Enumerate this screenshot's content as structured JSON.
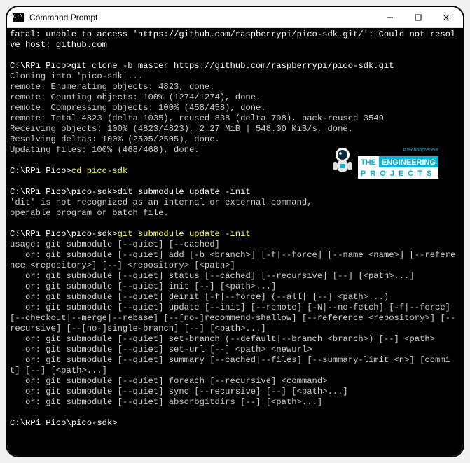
{
  "titlebar": {
    "icon_label": "C:\\",
    "title": "Command Prompt"
  },
  "logo": {
    "tag": "# technopreneur",
    "line1a": "THE",
    "line1b": "ENGINEERING",
    "line2": "PROJECTS"
  },
  "terminal_lines": [
    {
      "cls": "w",
      "text": "fatal: unable to access 'https://github.com/raspberrypi/pico-sdk.git/': Could not resolve host: github.com"
    },
    {
      "cls": "w",
      "text": ""
    },
    {
      "cls": "prompt",
      "text": "C:\\RPi Pico>git clone -b master https://github.com/raspberrypi/pico-sdk.git"
    },
    {
      "cls": "line",
      "text": "Cloning into 'pico-sdk'..."
    },
    {
      "cls": "line",
      "text": "remote: Enumerating objects: 4823, done."
    },
    {
      "cls": "line",
      "text": "remote: Counting objects: 100% (1274/1274), done."
    },
    {
      "cls": "line",
      "text": "remote: Compressing objects: 100% (458/458), done."
    },
    {
      "cls": "line",
      "text": "remote: Total 4823 (delta 1035), reused 838 (delta 798), pack-reused 3549"
    },
    {
      "cls": "line",
      "text": "Receiving objects: 100% (4823/4823), 2.27 MiB | 548.00 KiB/s, done."
    },
    {
      "cls": "line",
      "text": "Resolving deltas: 100% (2505/2505), done."
    },
    {
      "cls": "line",
      "text": "Updating files: 100% (468/468), done."
    },
    {
      "cls": "w",
      "text": ""
    },
    {
      "cls": "mixed",
      "prefix": "C:\\RPi Pico>",
      "cmd": "cd pico-sdk"
    },
    {
      "cls": "w",
      "text": ""
    },
    {
      "cls": "prompt",
      "text": "C:\\RPi Pico\\pico-sdk>dit submodule update -init"
    },
    {
      "cls": "line",
      "text": "'dit' is not recognized as an internal or external command,"
    },
    {
      "cls": "line",
      "text": "operable program or batch file."
    },
    {
      "cls": "w",
      "text": ""
    },
    {
      "cls": "mixed",
      "prefix": "C:\\RPi Pico\\pico-sdk>",
      "cmd": "git submodule update -init"
    },
    {
      "cls": "line",
      "text": "usage: git submodule [--quiet] [--cached]"
    },
    {
      "cls": "line",
      "text": "   or: git submodule [--quiet] add [-b <branch>] [-f|--force] [--name <name>] [--reference <repository>] [--] <repository> [<path>]"
    },
    {
      "cls": "line",
      "text": "   or: git submodule [--quiet] status [--cached] [--recursive] [--] [<path>...]"
    },
    {
      "cls": "line",
      "text": "   or: git submodule [--quiet] init [--] [<path>...]"
    },
    {
      "cls": "line",
      "text": "   or: git submodule [--quiet] deinit [-f|--force] (--all| [--] <path>...)"
    },
    {
      "cls": "line",
      "text": "   or: git submodule [--quiet] update [--init] [--remote] [-N|--no-fetch] [-f|--force] [--checkout|--merge|--rebase] [--[no-]recommend-shallow] [--reference <repository>] [--recursive] [--[no-]single-branch] [--] [<path>...]"
    },
    {
      "cls": "line",
      "text": "   or: git submodule [--quiet] set-branch (--default|--branch <branch>) [--] <path>"
    },
    {
      "cls": "line",
      "text": "   or: git submodule [--quiet] set-url [--] <path> <newurl>"
    },
    {
      "cls": "line",
      "text": "   or: git submodule [--quiet] summary [--cached|--files] [--summary-limit <n>] [commit] [--] [<path>...]"
    },
    {
      "cls": "line",
      "text": "   or: git submodule [--quiet] foreach [--recursive] <command>"
    },
    {
      "cls": "line",
      "text": "   or: git submodule [--quiet] sync [--recursive] [--] [<path>...]"
    },
    {
      "cls": "line",
      "text": "   or: git submodule [--quiet] absorbgitdirs [--] [<path>...]"
    },
    {
      "cls": "w",
      "text": ""
    },
    {
      "cls": "prompt",
      "text": "C:\\RPi Pico\\pico-sdk>"
    }
  ]
}
